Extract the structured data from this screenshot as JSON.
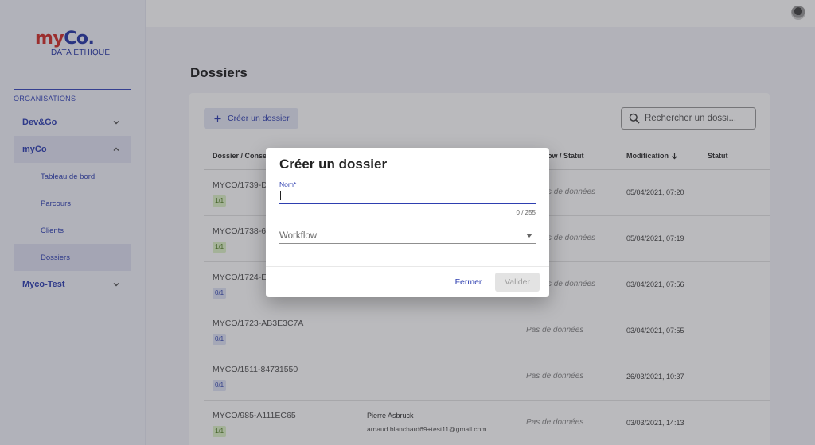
{
  "logo": {
    "main_left": "my",
    "main_right": "Co.",
    "sub": "DATA ÉTHIQUE"
  },
  "sidebar": {
    "section": "ORGANISATIONS",
    "groups": [
      {
        "label": "Dev&Go",
        "expanded": false
      },
      {
        "label": "myCo",
        "expanded": true
      },
      {
        "label": "Myco-Test",
        "expanded": false
      }
    ],
    "sub_items": [
      {
        "label": "Tableau de bord"
      },
      {
        "label": "Parcours"
      },
      {
        "label": "Clients"
      },
      {
        "label": "Dossiers",
        "active": true
      }
    ]
  },
  "page": {
    "title": "Dossiers"
  },
  "toolbar": {
    "create_label": "Créer un dossier",
    "search_placeholder": "Rechercher un dossi..."
  },
  "table": {
    "headers": [
      "Dossier / Conse",
      "ow / Statut",
      "Modification",
      "Statut"
    ],
    "rows": [
      {
        "id": "MYCO/1739-D",
        "badge": "1/1",
        "badge_color": "green",
        "nodata": "s de données",
        "date": "05/04/2021, 07:20"
      },
      {
        "id": "MYCO/1738-6",
        "badge": "1/1",
        "badge_color": "green",
        "nodata": "s de données",
        "date": "05/04/2021, 07:19"
      },
      {
        "id": "MYCO/1724-E",
        "badge": "0/1",
        "badge_color": "blue",
        "nodata": "s de données",
        "date": "03/04/2021, 07:56"
      },
      {
        "id": "MYCO/1723-AB3E3C7A",
        "badge": "0/1",
        "badge_color": "blue",
        "nodata": "Pas de données",
        "date": "03/04/2021, 07:55"
      },
      {
        "id": "MYCO/1511-84731550",
        "badge": "0/1",
        "badge_color": "blue",
        "nodata": "Pas de données",
        "date": "26/03/2021, 10:37"
      },
      {
        "id": "MYCO/985-A111EC65",
        "badge": "1/1",
        "badge_color": "green",
        "contact_name": "Pierre Asbruck",
        "contact_email": "arnaud.blanchard69+test11@gmail.com",
        "nodata": "Pas de données",
        "date": "03/03/2021, 14:13"
      }
    ]
  },
  "dialog": {
    "title": "Créer un dossier",
    "name_label": "Nom*",
    "name_value": "",
    "name_counter": "0 / 255",
    "workflow_placeholder": "Workflow",
    "cancel_label": "Fermer",
    "validate_label": "Valider"
  },
  "colors": {
    "accent": "#2e3fb0",
    "logo_red": "#d2322d",
    "badge_green_bg": "#dff3c9",
    "badge_blue_bg": "#e1e5f7"
  },
  "icons": [
    "avatar",
    "chevron-down-icon",
    "chevron-up-icon",
    "plus-icon",
    "search-icon",
    "sort-arrow-down-icon",
    "dropdown-arrow-icon"
  ]
}
